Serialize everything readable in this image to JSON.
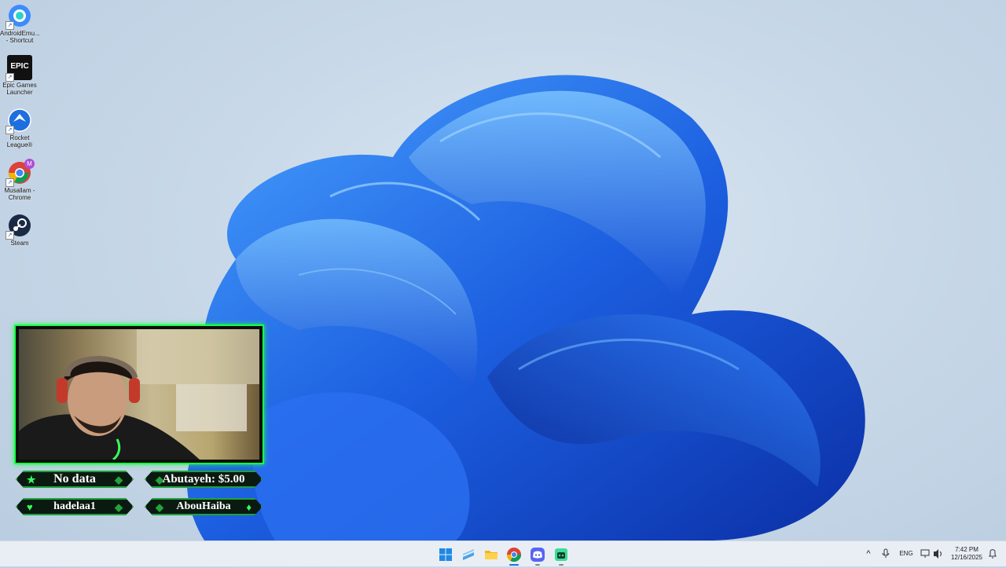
{
  "desktop": {
    "icons": [
      {
        "label": "AndroidEmu... - Shortcut",
        "icon": "android-emulator-icon"
      },
      {
        "label": "Epic Games Launcher",
        "icon": "epic-games-icon",
        "glyph": "EPIC"
      },
      {
        "label": "Rocket League®",
        "icon": "rocket-league-icon"
      },
      {
        "label": "Musallam - Chrome",
        "icon": "chrome-profile-icon",
        "glyph": "M"
      },
      {
        "label": "Steam",
        "icon": "steam-icon"
      }
    ]
  },
  "overlay": {
    "badges": [
      {
        "text": "No data",
        "icon": "star-icon"
      },
      {
        "text": "Abutayeh: $5.00",
        "icon": "donation-icon"
      },
      {
        "text": "hadelaa1",
        "icon": "heart-icon"
      },
      {
        "text": "AbouHaiba",
        "icon": "diamond-icon"
      }
    ]
  },
  "taskbar": {
    "apps": [
      {
        "name": "start-button",
        "icon": "windows-logo-icon"
      },
      {
        "name": "widgets-button",
        "icon": "widgets-icon"
      },
      {
        "name": "file-explorer-button",
        "icon": "folder-icon"
      },
      {
        "name": "chrome-button",
        "icon": "chrome-icon"
      },
      {
        "name": "discord-button",
        "icon": "discord-icon"
      },
      {
        "name": "app-button",
        "icon": "robot-app-icon"
      }
    ],
    "tray": {
      "language": "ENG",
      "time": "7:42 PM",
      "date": "12/16/2025"
    }
  },
  "colors": {
    "accent_green": "#1aff4a",
    "wallpaper_blue": "#1f63e0",
    "taskbar_bg": "#e9eef5"
  }
}
